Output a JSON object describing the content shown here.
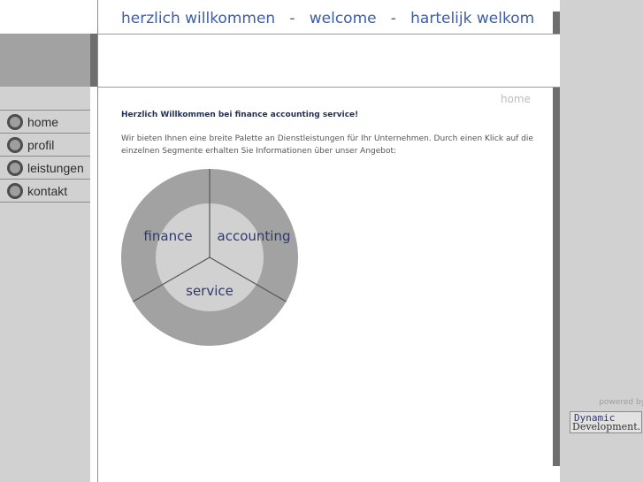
{
  "header": {
    "title": "herzlich willkommen   -   welcome   -   hartelijk welkom"
  },
  "nav": {
    "items": [
      {
        "label": "home"
      },
      {
        "label": "profil"
      },
      {
        "label": "leistungen"
      },
      {
        "label": "kontakt"
      }
    ]
  },
  "content": {
    "breadcrumb": "home",
    "welcome": "Herzlich Willkommen bei finance accounting service!",
    "intro": "Wir bieten Ihnen eine breite Palette an Dienstleistungen für Ihr Unternehmen. Durch einen Klick auf die einzelnen Segmente erhalten Sie Informationen über unser Angebot:"
  },
  "diagram": {
    "segments": [
      {
        "label": "finance"
      },
      {
        "label": "accounting"
      },
      {
        "label": "service"
      }
    ]
  },
  "footer": {
    "powered_by": "powered by",
    "logo_line1": "Dynamic",
    "logo_line2": "Development."
  },
  "colors": {
    "header_text": "#3b5ea8",
    "sidebar_bg": "#d1d1d1",
    "dark_bar": "#6e6e6e",
    "segment_outer": "#a2a2a2",
    "segment_inner": "#d1d1d1"
  }
}
